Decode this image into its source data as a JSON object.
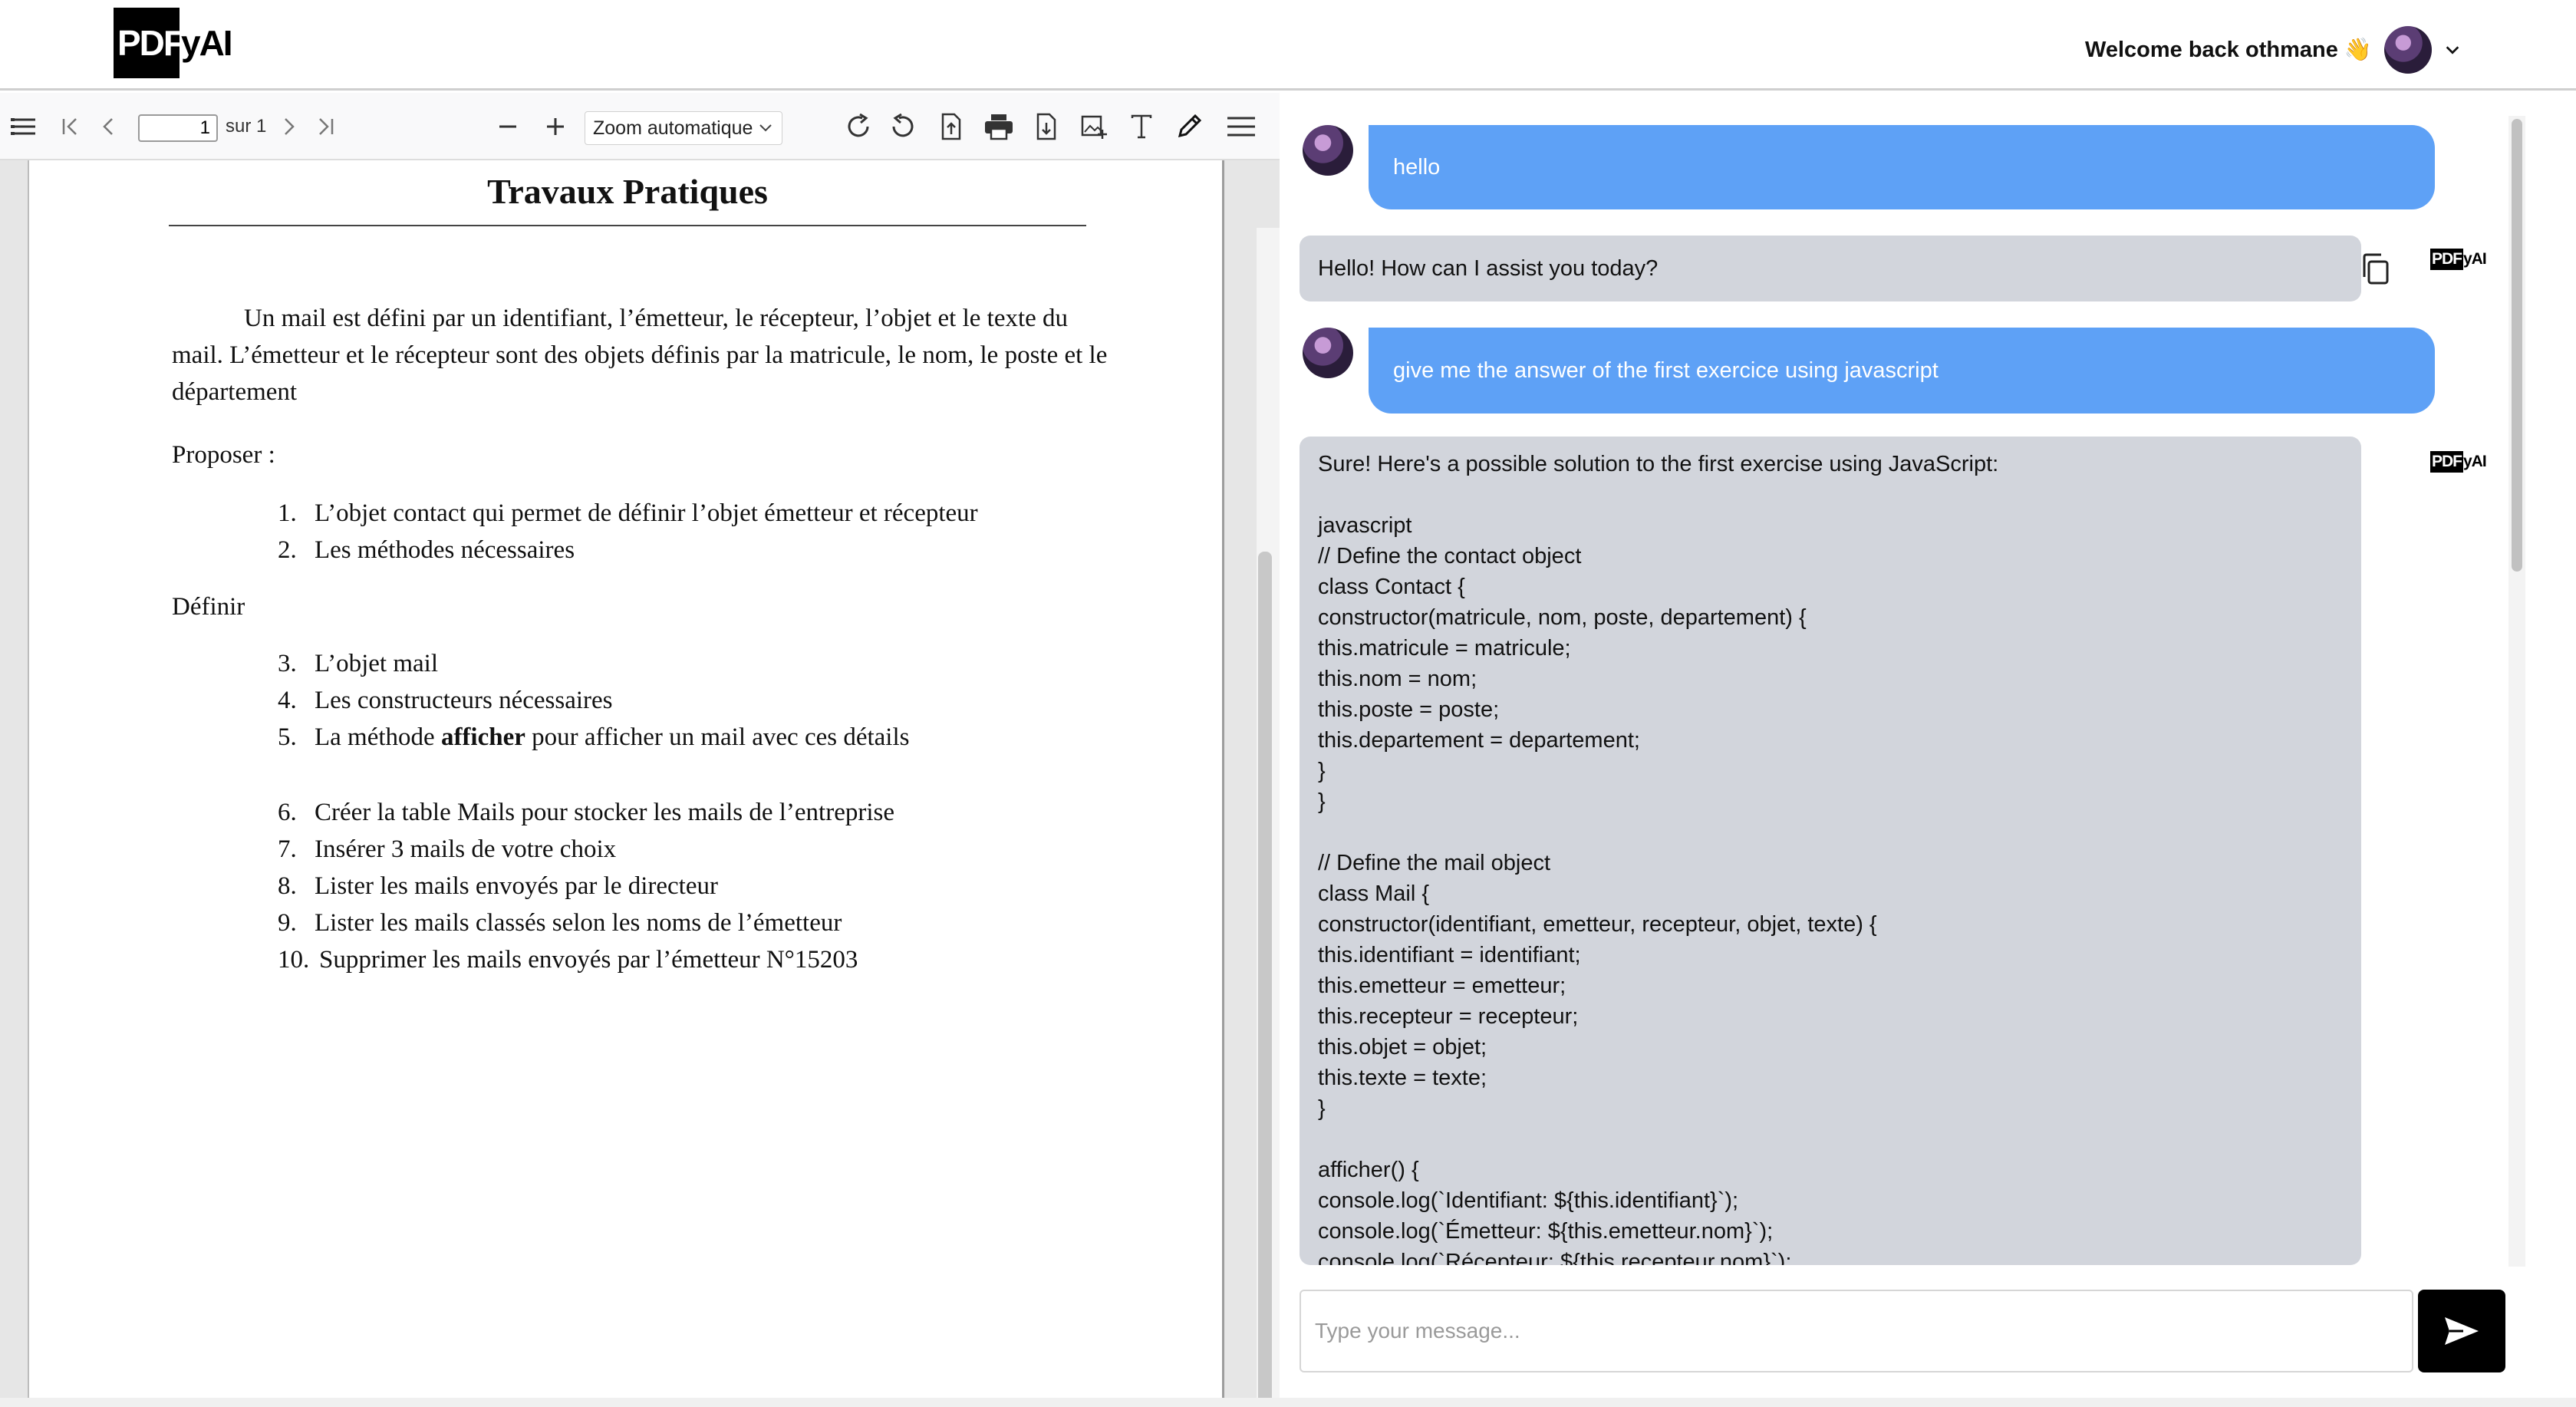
{
  "header": {
    "logo_box": "PDF",
    "logo_rest": "yAI",
    "welcome": "Welcome back othmane 👋"
  },
  "pdf_toolbar": {
    "page_value": "1",
    "page_total": "sur 1",
    "zoom": "Zoom automatique"
  },
  "document": {
    "title": "Travaux Pratiques",
    "intro": "Un mail est défini par un identifiant, l’émetteur, le récepteur, l’objet et le texte du mail. L’émetteur et le récepteur sont des objets définis par la matricule, le nom, le poste et le département",
    "proposer_heading": "Proposer :",
    "proposer_items": [
      {
        "n": "1.",
        "text": "L’objet contact qui permet de définir l’objet émetteur et récepteur"
      },
      {
        "n": "2.",
        "text": "Les méthodes nécessaires"
      }
    ],
    "definir_heading": "Définir",
    "definir_items": [
      {
        "n": "3.",
        "text": "L’objet mail"
      },
      {
        "n": "4.",
        "text": "Les constructeurs nécessaires"
      },
      {
        "n": "5.",
        "pre": "La méthode ",
        "bold": "afficher",
        "post": " pour afficher un mail avec ces détails"
      }
    ],
    "sql_items": [
      {
        "n": "6.",
        "text": "Créer la table Mails pour stocker les mails de l’entreprise"
      },
      {
        "n": "7.",
        "text": "Insérer 3 mails de votre choix"
      },
      {
        "n": "8.",
        "text": "Lister les mails envoyés par le directeur"
      },
      {
        "n": "9.",
        "text": "Lister les mails classés selon les noms de l’émetteur"
      },
      {
        "n": "10.",
        "text": "Supprimer les mails envoyés par l’émetteur N°15203"
      }
    ]
  },
  "chat": {
    "bot_logo_box": "PDF",
    "bot_logo_rest": "yAI",
    "messages": [
      {
        "role": "user",
        "text": "hello"
      },
      {
        "role": "bot",
        "text": "Hello! How can I assist you today?"
      },
      {
        "role": "user",
        "text": "give me the answer of the first exercice using javascript"
      }
    ],
    "code_response": [
      "Sure! Here's a possible solution to the first exercise using JavaScript:",
      "",
      "javascript",
      "// Define the contact object",
      "class Contact {",
      "constructor(matricule, nom, poste, departement) {",
      "this.matricule = matricule;",
      "this.nom = nom;",
      "this.poste = poste;",
      "this.departement = departement;",
      "}",
      "}",
      "",
      "// Define the mail object",
      "class Mail {",
      "constructor(identifiant, emetteur, recepteur, objet, texte) {",
      "this.identifiant = identifiant;",
      "this.emetteur = emetteur;",
      "this.recepteur = recepteur;",
      "this.objet = objet;",
      "this.texte = texte;",
      "}",
      "",
      "afficher() {",
      "console.log(`Identifiant: ${this.identifiant}`);",
      "console.log(`Émetteur: ${this.emetteur.nom}`);",
      "console.log(`Récepteur: ${this.recepteur.nom}`);"
    ],
    "input_placeholder": "Type your message..."
  }
}
